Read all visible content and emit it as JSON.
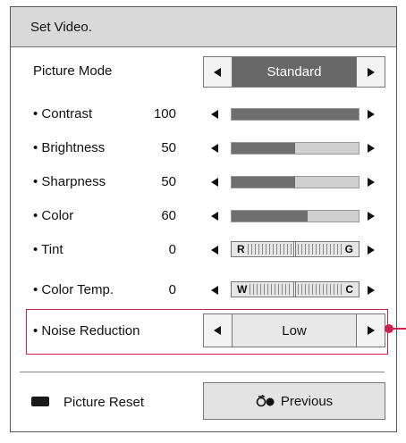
{
  "title": "Set Video.",
  "picture_mode": {
    "label": "Picture Mode",
    "value": "Standard"
  },
  "settings": [
    {
      "label": "• Contrast",
      "value": "100",
      "level": 1.0
    },
    {
      "label": "• Brightness",
      "value": "50",
      "level": 0.5
    },
    {
      "label": "• Sharpness",
      "value": "50",
      "level": 0.5
    },
    {
      "label": "• Color",
      "value": "60",
      "level": 0.6
    }
  ],
  "tint": {
    "label": "• Tint",
    "value": "0",
    "left_end": "R",
    "right_end": "G"
  },
  "color_temp": {
    "label": "• Color Temp.",
    "value": "0",
    "left_end": "W",
    "right_end": "C"
  },
  "noise_reduction": {
    "label": "• Noise Reduction",
    "value": "Low"
  },
  "footer": {
    "reset_label": "Picture Reset",
    "previous_label": "Previous",
    "previous_icon": "return-icon"
  },
  "colors": {
    "highlight": "#d02050",
    "bar_fill": "#6e6e6e",
    "bar_track": "#cfcfcf",
    "selected_bg": "#686868"
  }
}
